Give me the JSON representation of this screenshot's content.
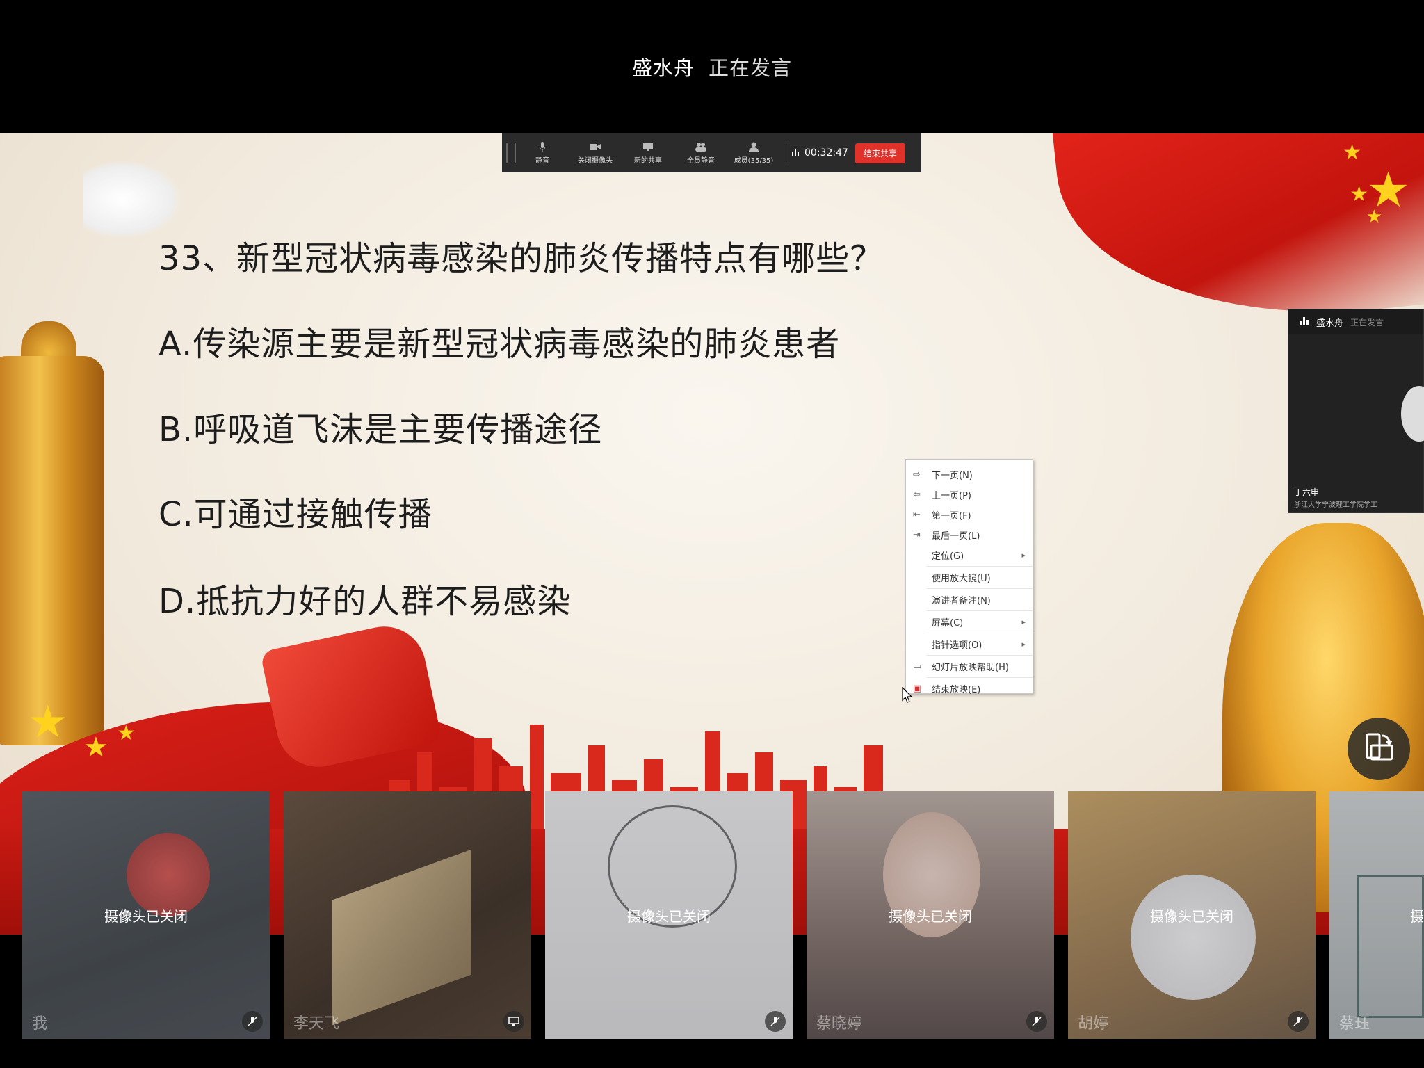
{
  "speaker_bar": {
    "name": "盛水舟",
    "status": "正在发言"
  },
  "toolbar": {
    "buttons": [
      {
        "label": "静音",
        "icon": "mic-icon"
      },
      {
        "label": "关闭摄像头",
        "icon": "camera-icon"
      },
      {
        "label": "新的共享",
        "icon": "share-screen-icon"
      },
      {
        "label": "全员静音",
        "icon": "mute-all-icon"
      },
      {
        "label": "成员(35/35)",
        "icon": "members-icon"
      }
    ],
    "timer": "00:32:47",
    "end_share": "结束共享"
  },
  "slide": {
    "question": "33、新型冠状病毒感染的肺炎传播特点有哪些？",
    "options": [
      {
        "key": "A.",
        "text": "传染源主要是新型冠状病毒感染的肺炎患者"
      },
      {
        "key": "B.",
        "text": "呼吸道飞沫是主要传播途径"
      },
      {
        "key": "C.",
        "text": "可通过接触传播"
      },
      {
        "key": "D.",
        "text": "抵抗力好的人群不易感染"
      }
    ]
  },
  "video_panel": {
    "speaker": "盛水舟",
    "status": "正在发言",
    "participant": "丁六申",
    "org": "浙江大学宁波理工学院学工"
  },
  "context_menu": {
    "items": [
      {
        "label": "下一页(N)",
        "icon": "arrow-right-icon"
      },
      {
        "label": "上一页(P)",
        "icon": "arrow-left-icon"
      },
      {
        "label": "第一页(F)",
        "icon": "first-page-icon"
      },
      {
        "label": "最后一页(L)",
        "icon": "last-page-icon"
      },
      {
        "label": "定位(G)",
        "submenu": true
      },
      {
        "label": "使用放大镜(U)"
      },
      {
        "label": "演讲者备注(N)"
      },
      {
        "label": "屏幕(C)",
        "submenu": true
      },
      {
        "label": "指针选项(O)",
        "submenu": true
      },
      {
        "label": "幻灯片放映帮助(H)",
        "icon": "help-icon"
      },
      {
        "label": "结束放映(E)",
        "icon": "end-show-icon"
      }
    ]
  },
  "participants": [
    {
      "name": "我",
      "status": "摄像头已关闭",
      "icon": "mic-muted-icon"
    },
    {
      "name": "李天飞",
      "status": "",
      "icon": "screen-icon"
    },
    {
      "name": "",
      "status": "摄像头已关闭",
      "icon": "mic-muted-icon"
    },
    {
      "name": "蔡晓婷",
      "status": "摄像头已关闭",
      "icon": "mic-muted-icon"
    },
    {
      "name": "胡婷",
      "status": "摄像头已关闭",
      "icon": "mic-muted-icon"
    },
    {
      "name": "蔡珏",
      "status": "摄",
      "icon": ""
    }
  ],
  "colors": {
    "accent_red": "#e0312b",
    "toolbar_bg": "#2b2b2b",
    "slide_text": "#1d1d1d"
  }
}
